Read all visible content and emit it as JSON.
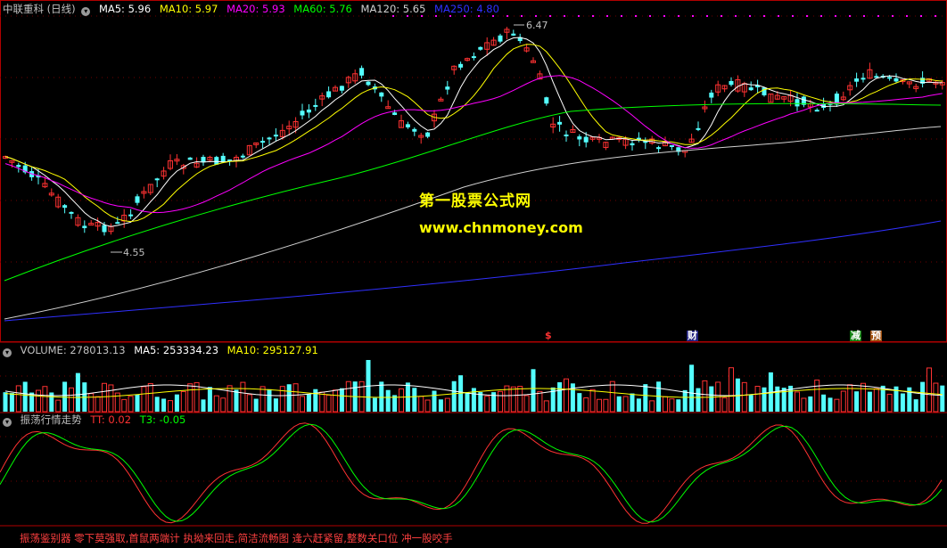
{
  "main_header": {
    "title": "中联重科 (日线)",
    "ma5": "MA5: 5.96",
    "ma10": "MA10: 5.97",
    "ma20": "MA20: 5.93",
    "ma60": "MA60: 5.76",
    "ma120": "MA120: 5.65",
    "ma250": "MA250: 4.80"
  },
  "annotations": {
    "high_label": "6.47",
    "low_label": "4.55"
  },
  "watermark": {
    "line1": "第一股票公式网",
    "line2": "www.chnmoney.com"
  },
  "events": [
    "$",
    "财",
    "减",
    "预"
  ],
  "volume_header": {
    "label": "VOLUME: 278013.13",
    "ma5": "MA5: 253334.23",
    "ma10": "MA10: 295127.91"
  },
  "osc_header": {
    "name": "振荡行情走势",
    "tt": "TT: 0.02",
    "t3": "T3: -0.05"
  },
  "footer": {
    "text": "振荡鉴别器 零下莫强取,首鼠两端计 执拗来回走,简洁流畅图 逢六赶紧留,整数关口位 冲一股咬手"
  },
  "colors": {
    "up": "#ff3232",
    "down": "#54ffff",
    "ma5": "#ffffff",
    "ma10": "#ffff00",
    "ma20": "#ff00ff",
    "ma60": "#00ff00",
    "ma120": "#d0d0d0",
    "ma250": "#3030ff",
    "grid": "#b00000"
  }
}
